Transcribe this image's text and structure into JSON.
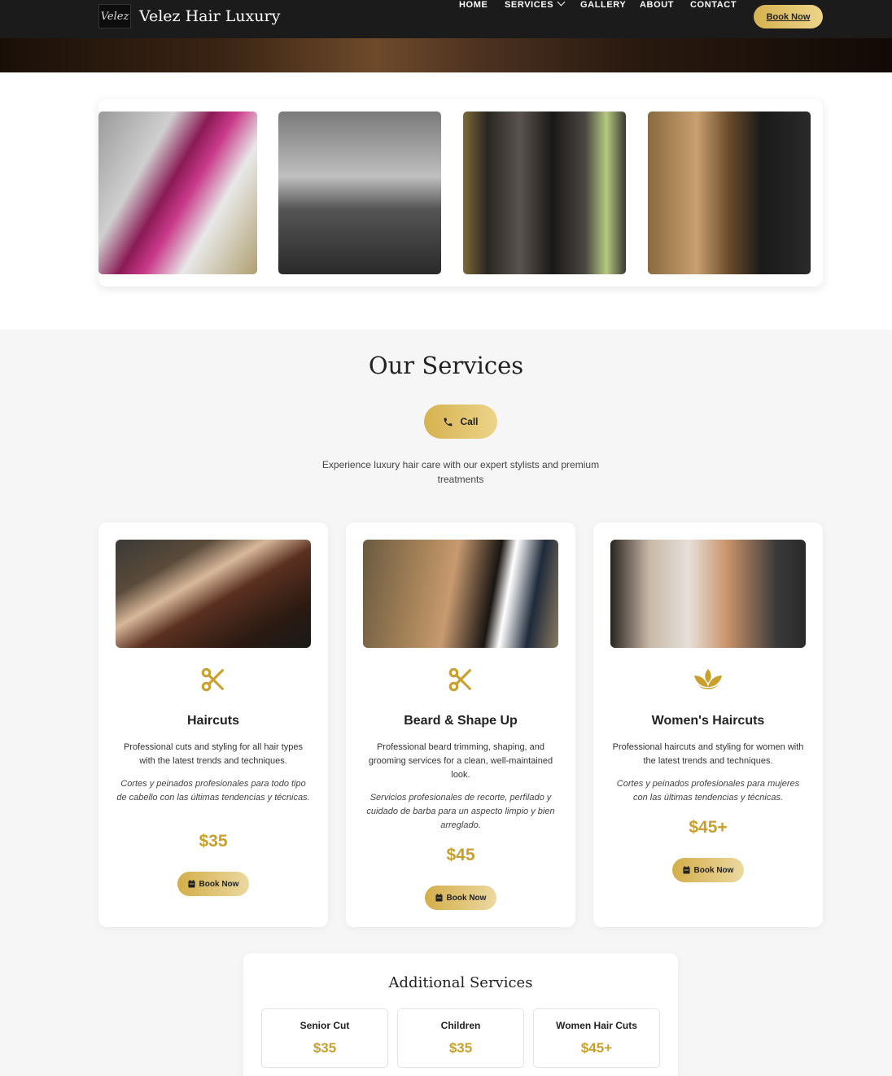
{
  "nav": {
    "logo_text": "Velez",
    "brand": "Velez Hair Luxury",
    "items": [
      "HOME",
      "SERVICES",
      "GALLERY",
      "ABOUT",
      "CONTACT"
    ],
    "book_label": "Book Now"
  },
  "services": {
    "title": "Our Services",
    "call_label": "Call",
    "intro": "Experience luxury hair care with our expert stylists and premium treatments",
    "cards": [
      {
        "title": "Haircuts",
        "desc": "Professional cuts and styling for all hair types with the latest trends and techniques.",
        "desc_es": "Cortes y peinados profesionales para todo tipo de cabello con las últimas tendencias y técnicas.",
        "price": "$35",
        "button": "Book Now",
        "icon": "scissors-icon"
      },
      {
        "title": "Beard & Shape Up",
        "desc": "Professional beard trimming, shaping, and grooming services for a clean, well-maintained look.",
        "desc_es": "Servicios profesionales de recorte, perfilado y cuidado de barba para un aspecto limpio y bien arreglado.",
        "price": "$45",
        "button": "Book Now",
        "icon": "scissors-icon"
      },
      {
        "title": "Women's Haircuts",
        "desc": "Professional haircuts and styling for women with the latest trends and techniques.",
        "desc_es": "Cortes y peinados profesionales para mujeres con las últimas tendencias y técnicas.",
        "price": "$45+",
        "button": "Book Now",
        "icon": "lotus-icon"
      }
    ]
  },
  "additional": {
    "title": "Additional Services",
    "items": [
      {
        "name": "Senior Cut",
        "price": "$35"
      },
      {
        "name": "Children",
        "price": "$35"
      },
      {
        "name": "Women Hair Cuts",
        "price": "$45+"
      }
    ]
  },
  "colors": {
    "gold": "#c9a02e",
    "nav_bg": "#1b1b1b",
    "button_gradient_start": "#d6b24f",
    "button_gradient_end": "#ecd48a"
  }
}
